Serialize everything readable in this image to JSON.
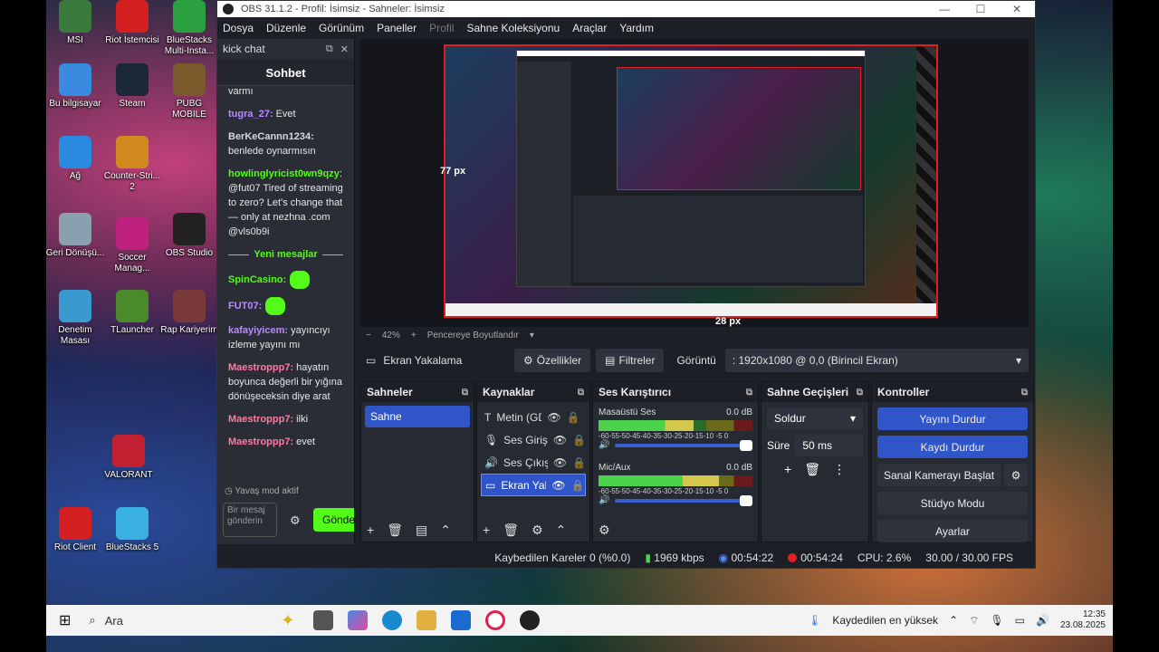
{
  "desktop": {
    "icons": [
      {
        "label": "MSI",
        "color": "#3a7a3a"
      },
      {
        "label": "Riot İstemcisi",
        "color": "#d42020"
      },
      {
        "label": "BlueStacks Multi-Insta...",
        "color": "#2aa040"
      },
      {
        "label": "Bu bilgisayar",
        "color": "#3a8ae0"
      },
      {
        "label": "Steam",
        "color": "#1b2838"
      },
      {
        "label": "PUBG MOBILE",
        "color": "#7a5a2a"
      },
      {
        "label": "Ağ",
        "color": "#2a8ae0"
      },
      {
        "label": "Counter-Stri... 2",
        "color": "#d08a20"
      },
      {
        "label": "Geri Dönüşü...",
        "color": "#8aa0b0"
      },
      {
        "label": "Soccer Manag...",
        "color": "#c02080"
      },
      {
        "label": "OBS Studio",
        "color": "#222222"
      },
      {
        "label": "Denetim Masası",
        "color": "#3a9ad0"
      },
      {
        "label": "TLauncher",
        "color": "#4a8a2a"
      },
      {
        "label": "Rap Kariyerim",
        "color": "#7a3a3a"
      },
      {
        "label": "VALORANT",
        "color": "#c02030"
      },
      {
        "label": "Riot Client",
        "color": "#d42020"
      },
      {
        "label": "BlueStacks 5",
        "color": "#3ab0e0"
      }
    ]
  },
  "obs": {
    "title": "OBS 31.1.2 - Profil: İsimsiz - Sahneler: İsimsiz",
    "menu": [
      "Dosya",
      "Düzenle",
      "Görünüm",
      "Paneller",
      "Profil",
      "Sahne Koleksiyonu",
      "Araçlar",
      "Yardım"
    ],
    "chat": {
      "dock_title": "kick chat",
      "title": "Sohbet",
      "cut_top": "varmı",
      "messages": [
        {
          "user": "tugra_27:",
          "text": " Evet",
          "cls": "v"
        },
        {
          "user": "BerKeCannn1234:",
          "text": " benlede oynarmısın",
          "cls": "w"
        },
        {
          "user": "howlinglyricist0wn9qzy",
          "text": ": @fut07 Tired of streaming to zero? Let's change that — only at nezhna .com @vls0b9i",
          "cls": "g"
        }
      ],
      "new_messages": "Yeni mesajlar",
      "messages2": [
        {
          "user": "SpinCasino:",
          "text": "",
          "cls": "g",
          "emote": true
        },
        {
          "user": "FUT07:",
          "text": "",
          "cls": "v",
          "emote": true
        },
        {
          "user": "kafayiyicem:",
          "text": " yayıncıyı izleme yayını mı",
          "cls": "v"
        },
        {
          "user": "Maestroppp7:",
          "text": " hayatın boyunca değerli bir yığına dönüşeceksin diye arat",
          "cls": "p"
        },
        {
          "user": "Maestroppp7:",
          "text": " ilki",
          "cls": "p"
        },
        {
          "user": "Maestroppp7:",
          "text": " evet",
          "cls": "p"
        }
      ],
      "slow_mode": "Yavaş mod aktif",
      "input_placeholder": "Bir mesaj gönderin",
      "send": "Gönder"
    },
    "preview": {
      "label_left": "77 px",
      "label_bottom": "28 px",
      "zoom": "42%",
      "fit": "Pencereye Boyutlandır"
    },
    "source_bar": {
      "name": "Ekran Yakalama",
      "properties": "Özellikler",
      "filters": "Filtreler",
      "display_label": "Görüntü",
      "display_value": ": 1920x1080 @ 0,0 (Birincil Ekran)"
    },
    "scenes": {
      "title": "Sahneler",
      "items": [
        "Sahne"
      ]
    },
    "sources": {
      "title": "Kaynaklar",
      "items": [
        "Metin (GD",
        "Ses Giriş \\",
        "Ses Çıkış \\",
        "Ekran Yak"
      ]
    },
    "mixer": {
      "title": "Ses Karıştırıcı",
      "channels": [
        {
          "name": "Masaüstü Ses",
          "db": "0.0 dB",
          "level": 0.62
        },
        {
          "name": "Mic/Aux",
          "db": "0.0 dB",
          "level": 0.78
        }
      ],
      "scale": "-60-55-50-45-40-35-30-25-20-15-10 -5 0"
    },
    "transitions": {
      "title": "Sahne Geçişleri",
      "type": "Soldur",
      "duration_label": "Süre",
      "duration": "50 ms"
    },
    "controls": {
      "title": "Kontroller",
      "buttons": [
        "Yayını Durdur",
        "Kaydı Durdur",
        "Sanal Kamerayı Başlat",
        "Stüdyo Modu",
        "Ayarlar"
      ]
    },
    "status": {
      "dropped": "Kaybedilen Kareler 0 (%0.0)",
      "bitrate": "1969 kbps",
      "stream_time": "00:54:22",
      "rec_time": "00:54:24",
      "cpu": "CPU: 2.6%",
      "fps": "30.00 / 30.00 FPS"
    }
  },
  "taskbar": {
    "search": "Ara",
    "notify": "Kaydedilen en yüksek",
    "time": "12:35",
    "date": "23.08.2025"
  }
}
